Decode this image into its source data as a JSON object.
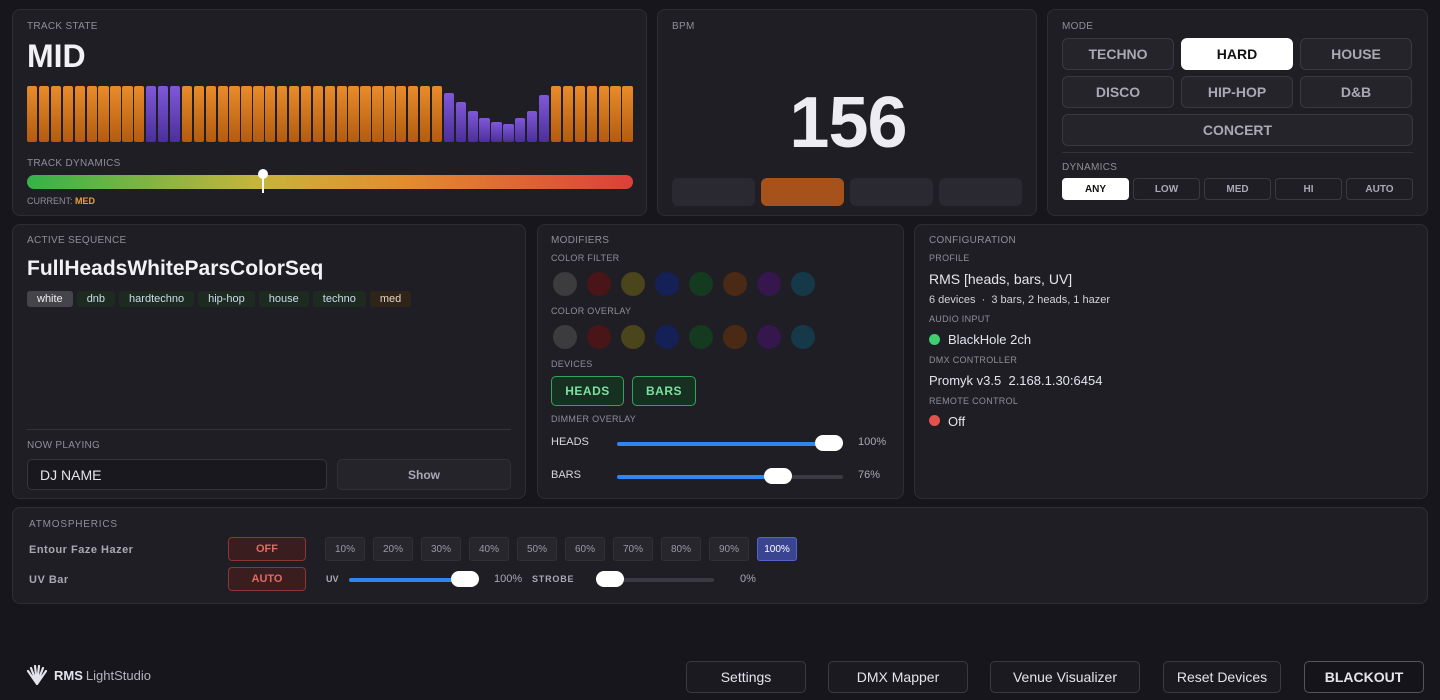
{
  "track_state": {
    "label": "TRACK STATE",
    "value": "MID",
    "dynamics_label": "TRACK DYNAMICS",
    "current_label": "CURRENT:",
    "current_value": "MED",
    "dynamics_level": 0.39,
    "spectrum": [
      {
        "h": 1.0,
        "c": "o"
      },
      {
        "h": 1.0,
        "c": "o"
      },
      {
        "h": 1.0,
        "c": "o"
      },
      {
        "h": 1.0,
        "c": "o"
      },
      {
        "h": 1.0,
        "c": "o"
      },
      {
        "h": 1.0,
        "c": "o"
      },
      {
        "h": 1.0,
        "c": "o"
      },
      {
        "h": 1.0,
        "c": "o"
      },
      {
        "h": 1.0,
        "c": "o"
      },
      {
        "h": 1.0,
        "c": "o"
      },
      {
        "h": 1.0,
        "c": "p"
      },
      {
        "h": 1.0,
        "c": "p"
      },
      {
        "h": 1.0,
        "c": "p"
      },
      {
        "h": 1.0,
        "c": "o"
      },
      {
        "h": 1.0,
        "c": "o"
      },
      {
        "h": 1.0,
        "c": "o"
      },
      {
        "h": 1.0,
        "c": "o"
      },
      {
        "h": 1.0,
        "c": "o"
      },
      {
        "h": 1.0,
        "c": "o"
      },
      {
        "h": 1.0,
        "c": "o"
      },
      {
        "h": 1.0,
        "c": "o"
      },
      {
        "h": 1.0,
        "c": "o"
      },
      {
        "h": 1.0,
        "c": "o"
      },
      {
        "h": 1.0,
        "c": "o"
      },
      {
        "h": 1.0,
        "c": "o"
      },
      {
        "h": 1.0,
        "c": "o"
      },
      {
        "h": 1.0,
        "c": "o"
      },
      {
        "h": 1.0,
        "c": "o"
      },
      {
        "h": 1.0,
        "c": "o"
      },
      {
        "h": 1.0,
        "c": "o"
      },
      {
        "h": 1.0,
        "c": "o"
      },
      {
        "h": 1.0,
        "c": "o"
      },
      {
        "h": 1.0,
        "c": "o"
      },
      {
        "h": 1.0,
        "c": "o"
      },
      {
        "h": 1.0,
        "c": "o"
      },
      {
        "h": 0.88,
        "c": "p"
      },
      {
        "h": 0.72,
        "c": "p"
      },
      {
        "h": 0.56,
        "c": "p"
      },
      {
        "h": 0.42,
        "c": "p"
      },
      {
        "h": 0.36,
        "c": "p"
      },
      {
        "h": 0.32,
        "c": "p"
      },
      {
        "h": 0.42,
        "c": "p"
      },
      {
        "h": 0.56,
        "c": "p"
      },
      {
        "h": 0.84,
        "c": "p"
      },
      {
        "h": 1.0,
        "c": "o"
      },
      {
        "h": 1.0,
        "c": "o"
      },
      {
        "h": 1.0,
        "c": "o"
      },
      {
        "h": 1.0,
        "c": "o"
      },
      {
        "h": 1.0,
        "c": "o"
      },
      {
        "h": 1.0,
        "c": "o"
      },
      {
        "h": 1.0,
        "c": "o"
      }
    ]
  },
  "bpm": {
    "label": "BPM",
    "value": "156",
    "beats": [
      false,
      true,
      false,
      false
    ]
  },
  "mode": {
    "label": "MODE",
    "buttons": [
      {
        "label": "TECHNO",
        "active": false
      },
      {
        "label": "HARD",
        "active": true
      },
      {
        "label": "HOUSE",
        "active": false
      },
      {
        "label": "DISCO",
        "active": false
      },
      {
        "label": "HIP-HOP",
        "active": false
      },
      {
        "label": "D&B",
        "active": false
      },
      {
        "label": "CONCERT",
        "active": false
      }
    ],
    "dynamics_label": "DYNAMICS",
    "dynamics": [
      {
        "label": "ANY",
        "active": true
      },
      {
        "label": "LOW",
        "active": false
      },
      {
        "label": "MED",
        "active": false
      },
      {
        "label": "HI",
        "active": false
      },
      {
        "label": "AUTO",
        "active": false
      }
    ]
  },
  "active_sequence": {
    "label": "ACTIVE SEQUENCE",
    "name": "FullHeadsWhiteParsColorSeq",
    "tags": [
      "white",
      "dnb",
      "hardtechno",
      "hip-hop",
      "house",
      "techno",
      "med"
    ],
    "now_playing_label": "NOW PLAYING",
    "dj_name": "DJ NAME",
    "show_label": "Show"
  },
  "modifiers": {
    "label": "MODIFIERS",
    "color_filter_label": "COLOR FILTER",
    "color_overlay_label": "COLOR OVERLAY",
    "colors": [
      "#3c3c3f",
      "#4a1518",
      "#4a451a",
      "#142056",
      "#143a1f",
      "#4a2a14",
      "#35164d",
      "#16394a"
    ],
    "devices_label": "DEVICES",
    "devices": [
      "HEADS",
      "BARS"
    ],
    "dimmer_label": "DIMMER OVERLAY",
    "dimmers": [
      {
        "name": "HEADS",
        "value": "100%",
        "level": 1.0
      },
      {
        "name": "BARS",
        "value": "76%",
        "level": 0.76
      }
    ]
  },
  "configuration": {
    "label": "CONFIGURATION",
    "profile_label": "PROFILE",
    "profile": "RMS [heads, bars, UV]",
    "devices_summary": "6 devices  ·  3 bars, 2 heads, 1 hazer",
    "audio_label": "AUDIO INPUT",
    "audio": "BlackHole 2ch",
    "audio_status_color": "#3ecf6e",
    "dmx_label": "DMX CONTROLLER",
    "dmx": "Promyk v3.5  2.168.1.30:6454",
    "remote_label": "REMOTE CONTROL",
    "remote": "Off",
    "remote_status_color": "#e4524e"
  },
  "atmospherics": {
    "label": "ATMOSPHERICS",
    "hazer_name": "Entour Faze Hazer",
    "hazer_state": "OFF",
    "hazer_levels": [
      "10%",
      "20%",
      "30%",
      "40%",
      "50%",
      "60%",
      "70%",
      "80%",
      "90%",
      "100%"
    ],
    "hazer_selected": "100%",
    "uv_name": "UV Bar",
    "uv_state": "AUTO",
    "uv_label": "UV",
    "uv_value": "100%",
    "uv_level": 1.0,
    "strobe_label": "STROBE",
    "strobe_value": "0%",
    "strobe_level": 0.0
  },
  "footer": {
    "brand": "RMS",
    "brand_sub": "LightStudio",
    "buttons": [
      "Settings",
      "DMX Mapper",
      "Venue Visualizer",
      "Reset Devices",
      "BLACKOUT"
    ]
  }
}
